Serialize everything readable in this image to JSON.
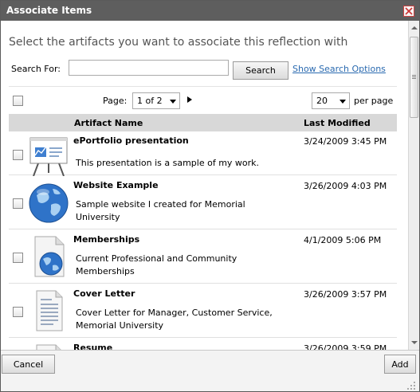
{
  "dialog": {
    "title": "Associate Items",
    "close_icon": "close-x-icon",
    "close_color": "#cc3333"
  },
  "instruction": "Select the artifacts you want to associate this reflection with",
  "search": {
    "label": "Search For:",
    "value": "",
    "placeholder": "",
    "button_label": "Search",
    "options_link": "Show Search Options"
  },
  "pager": {
    "page_label": "Page:",
    "page_value": "1 of 2",
    "next_icon": "next-page-icon",
    "page_size": "20",
    "per_page_label": "per page"
  },
  "table": {
    "columns": [
      "Artifact Name",
      "Last Modified"
    ],
    "rows": [
      {
        "name": "ePortfolio presentation",
        "description": "This presentation is a sample of my work.",
        "modified": "3/24/2009 3:45 PM",
        "icon": "presentation-icon"
      },
      {
        "name": "Website Example",
        "description": "Sample website I created for Memorial University",
        "modified": "3/26/2009 4:03 PM",
        "icon": "globe-icon"
      },
      {
        "name": "Memberships",
        "description": "Current Professional and Community Memberships",
        "modified": "4/1/2009 5:06 PM",
        "icon": "web-page-icon"
      },
      {
        "name": "Cover Letter",
        "description": "Cover Letter for Manager, Customer Service, Memorial University",
        "modified": "3/26/2009 3:57 PM",
        "icon": "document-icon"
      },
      {
        "name": "Resume",
        "description": "",
        "modified": "3/26/2009 3:59 PM",
        "icon": "document-icon"
      }
    ]
  },
  "footer": {
    "cancel_label": "Cancel",
    "add_label": "Add"
  },
  "colors": {
    "titlebar": "#5e5e5e",
    "header_row": "#d8d8d8",
    "link": "#2a6ab0"
  }
}
